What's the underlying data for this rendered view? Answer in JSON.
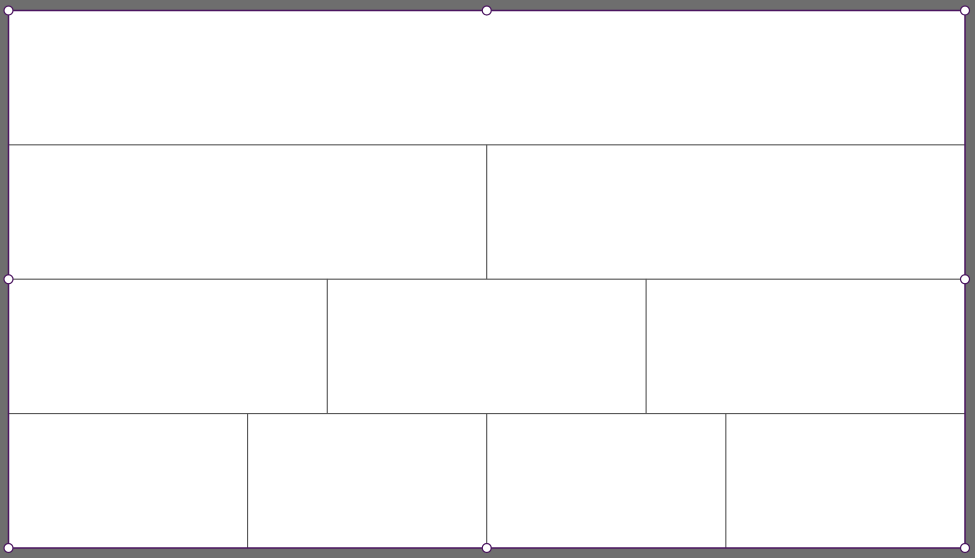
{
  "colors": {
    "background": "#6e6e6e",
    "paper": "#ffffff",
    "divider": "#555555",
    "selection": "#4b1560",
    "handle_fill": "#ffffff"
  },
  "layout_rows": [
    {
      "name": "row-1",
      "panels": 1
    },
    {
      "name": "row-2",
      "panels": 2
    },
    {
      "name": "row-3",
      "panels": 3
    },
    {
      "name": "row-4",
      "panels": 4
    }
  ],
  "selection_handles": [
    "top-left",
    "top-center",
    "top-right",
    "middle-left",
    "middle-right",
    "bottom-left",
    "bottom-center",
    "bottom-right"
  ]
}
